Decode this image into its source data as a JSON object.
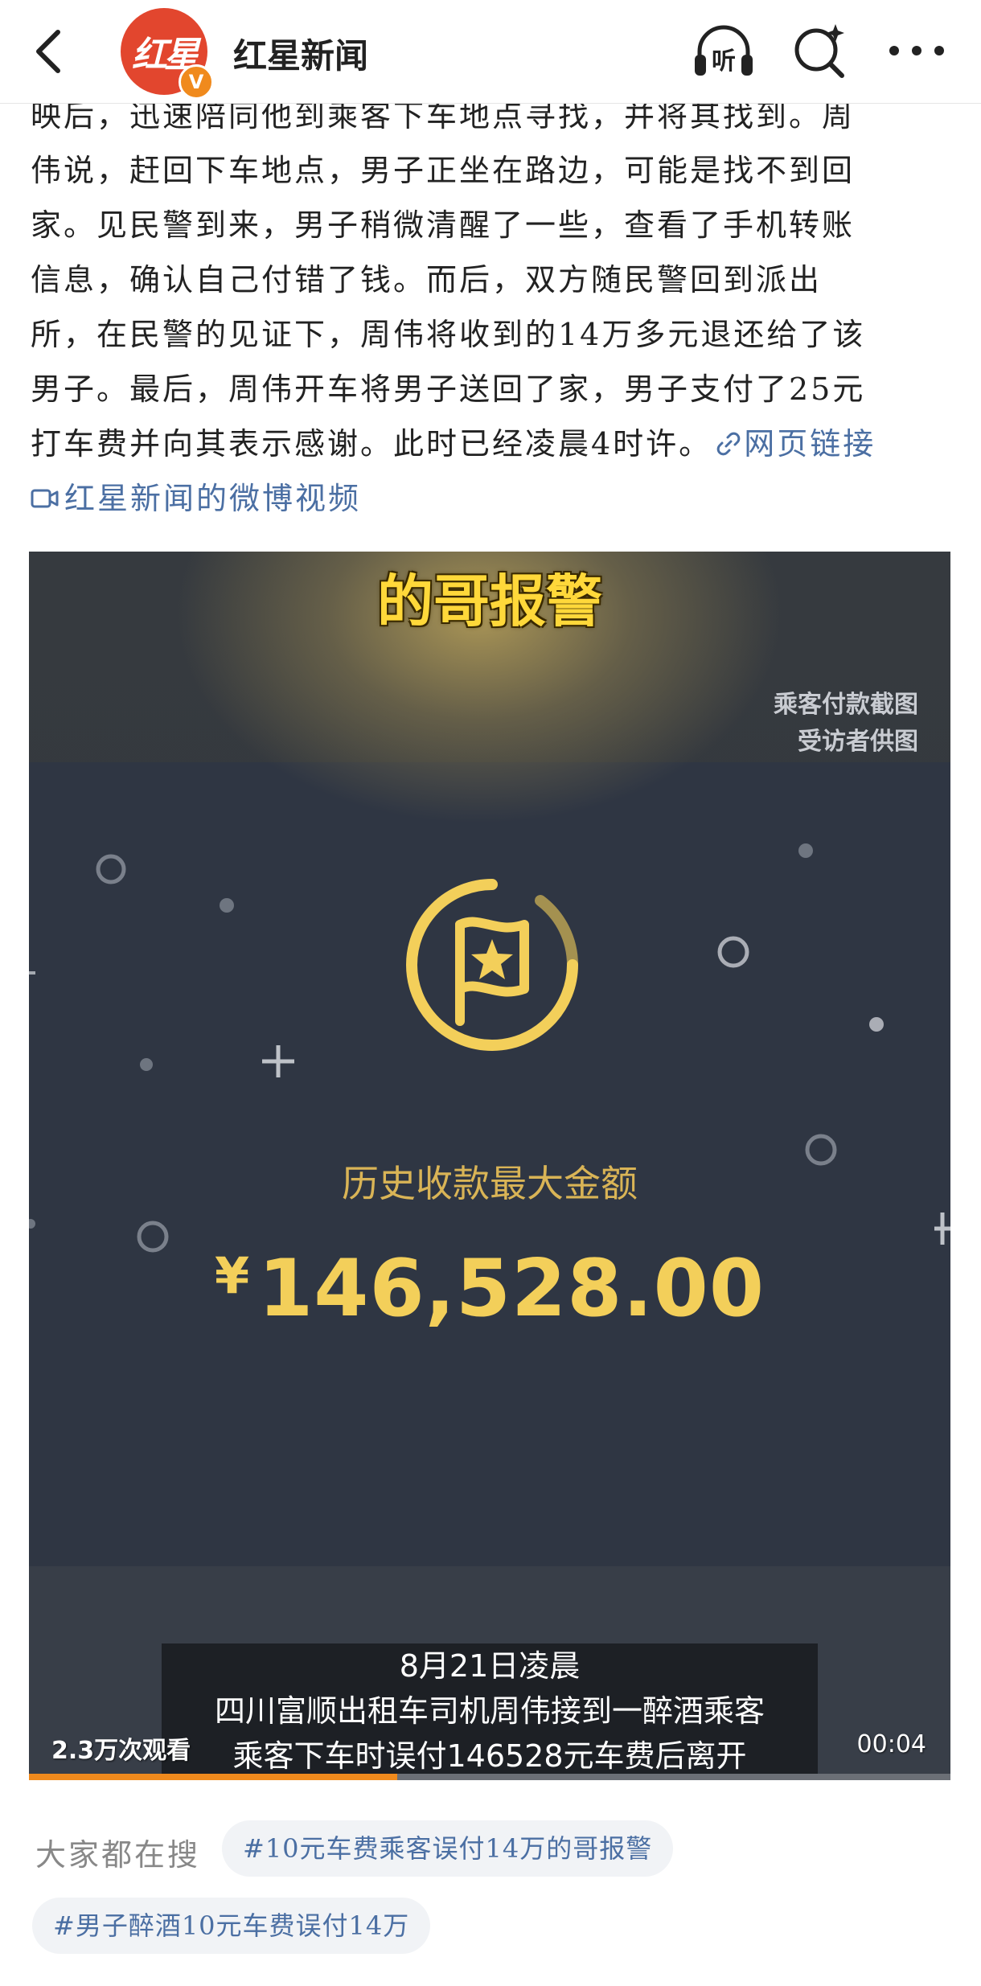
{
  "nav": {
    "account_name": "红星新闻",
    "logo_text": "红星",
    "verified_mark": "V",
    "listen_label": "听"
  },
  "article": {
    "lines": [
      "映后，迅速陪同他到乘客下车地点寻找，并将其找到。周",
      "伟说，赶回下车地点，男子正坐在路边，可能是找不到回",
      "家。见民警到来，男子稍微清醒了一些，查看了手机转账",
      "信息，确认自己付错了钱。而后，双方随民警回到派出",
      "所，在民警的见证下，周伟将收到的14万多元退还给了该",
      "男子。最后，周伟开车将男子送回了家，男子支付了25元"
    ],
    "last_line": "打车费并向其表示感谢。此时已经凌晨4时许。",
    "web_link": "网页链接",
    "video_link": "红星新闻的微博视频"
  },
  "video": {
    "headline": "的哥报警",
    "source_lines": [
      "乘客付款截图",
      "受访者供图"
    ],
    "history_label": "历史收款最大金额",
    "currency": "¥",
    "amount": "146,528.00",
    "subtitle_lines": [
      "8月21日凌晨",
      "四川富顺出租车司机周伟接到一醉酒乘客",
      "乘客下车时误付146528元车费后离开"
    ],
    "views": "2.3万次观看",
    "duration": "00:04",
    "progress": 0.4,
    "colors": {
      "accent": "#f08a1d",
      "gold": "#f3cf5a",
      "bg": "#2f3643"
    }
  },
  "search": {
    "label": "大家都在搜",
    "chips": [
      "#10元车费乘客误付14万的哥报警",
      "#男子醉酒10元车费误付14万"
    ]
  }
}
